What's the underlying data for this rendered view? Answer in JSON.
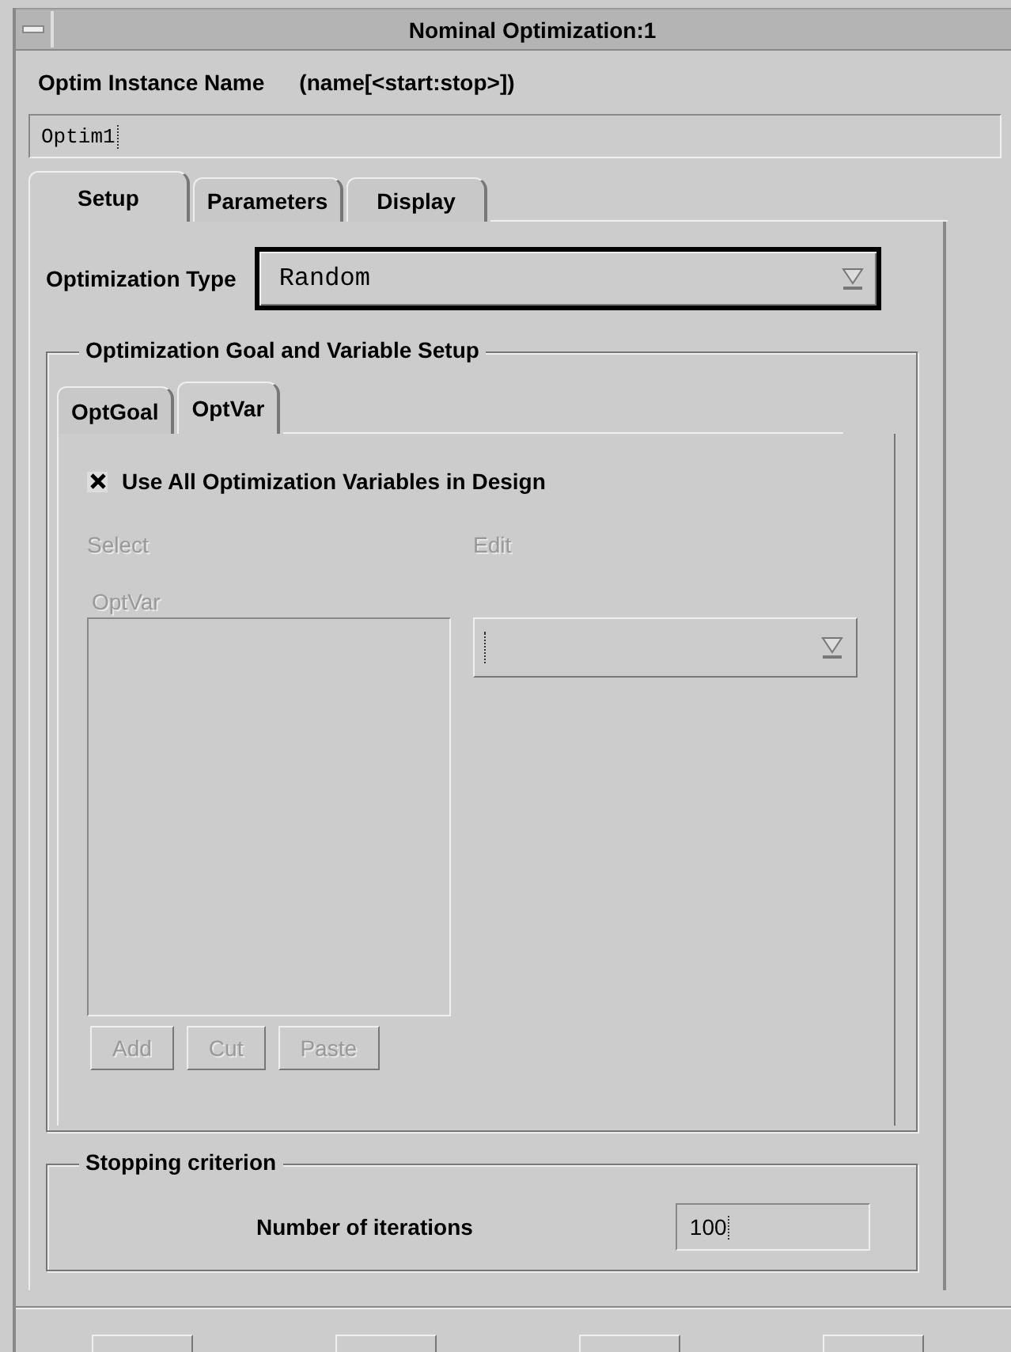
{
  "window": {
    "title": "Nominal Optimization:1"
  },
  "instance_name": {
    "label": "Optim Instance Name",
    "hint": "(name[<start:stop>])",
    "value": "Optim1"
  },
  "tabs": [
    {
      "label": "Setup",
      "selected": true
    },
    {
      "label": "Parameters",
      "selected": false
    },
    {
      "label": "Display",
      "selected": false
    }
  ],
  "optimization_type": {
    "label": "Optimization Type",
    "value": "Random"
  },
  "goal_group": {
    "title": "Optimization Goal and Variable Setup",
    "tabs": [
      {
        "label": "OptGoal",
        "selected": false
      },
      {
        "label": "OptVar",
        "selected": true
      }
    ],
    "use_all": {
      "label": "Use All Optimization Variables in Design",
      "checked": true
    },
    "select_label": {
      "text": "Select",
      "disabled": true
    },
    "edit_label": {
      "text": "Edit",
      "disabled": true
    },
    "list_label": {
      "text": "OptVar",
      "disabled": true
    },
    "buttons": [
      {
        "label": "Add",
        "disabled": true
      },
      {
        "label": "Cut",
        "disabled": true
      },
      {
        "label": "Paste",
        "disabled": true
      }
    ]
  },
  "stopping": {
    "title": "Stopping criterion",
    "label": "Number of iterations",
    "value": "100"
  }
}
